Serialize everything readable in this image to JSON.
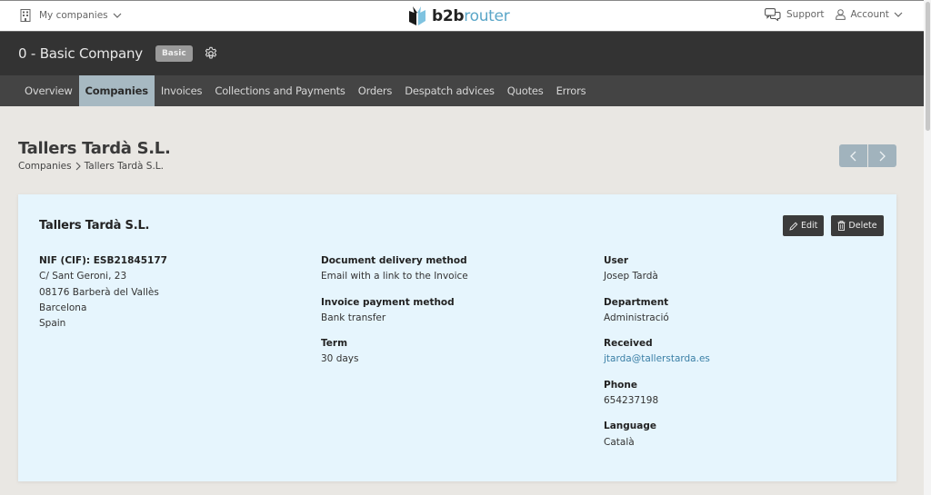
{
  "topbar": {
    "companies_label": "My companies",
    "logo_bold": "b2b",
    "logo_light": "router",
    "support_label": "Support",
    "account_label": "Account"
  },
  "company": {
    "name": "0 - Basic Company",
    "plan_badge": "Basic"
  },
  "nav": {
    "items": [
      {
        "label": "Overview"
      },
      {
        "label": "Companies",
        "active": true
      },
      {
        "label": "Invoices"
      },
      {
        "label": "Collections and Payments"
      },
      {
        "label": "Orders"
      },
      {
        "label": "Despatch advices"
      },
      {
        "label": "Quotes"
      },
      {
        "label": "Errors"
      }
    ]
  },
  "page": {
    "title": "Tallers Tardà S.L.",
    "breadcrumb": [
      "Companies",
      "Tallers Tardà S.L."
    ]
  },
  "card": {
    "title": "Tallers Tardà S.L.",
    "edit_label": "Edit",
    "delete_label": "Delete",
    "address": {
      "tax_id": "NIF (CIF): ESB21845177",
      "street": "C/ Sant Geroni, 23",
      "city": "08176 Barberà del Vallès",
      "province": "Barcelona",
      "country": "Spain"
    },
    "billing": [
      {
        "label": "Document delivery method",
        "value": "Email with a link to the Invoice"
      },
      {
        "label": "Invoice payment method",
        "value": "Bank transfer"
      },
      {
        "label": "Term",
        "value": "30 days"
      }
    ],
    "contact": [
      {
        "label": "User",
        "value": "Josep Tardà"
      },
      {
        "label": "Department",
        "value": "Administració"
      },
      {
        "label": "Received",
        "value": "jtarda@tallerstarda.es",
        "is_link": true
      },
      {
        "label": "Phone",
        "value": "654237198"
      },
      {
        "label": "Language",
        "value": "Català"
      }
    ]
  },
  "colors": {
    "brand_blue": "#5aa6c8",
    "active_tab": "#a7b9c2",
    "card_bg": "#e6f5fd",
    "link": "#3a7fa6"
  }
}
